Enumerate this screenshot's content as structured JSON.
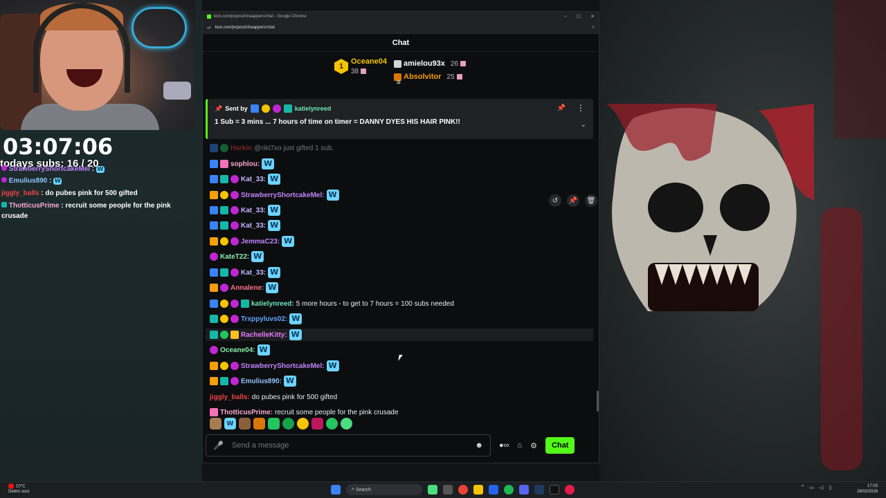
{
  "overlay": {
    "timer": "03:07:06",
    "subs_label": "todays subs: 16 / 20",
    "lines": [
      {
        "name": "StrawberryShortcakeMel",
        "color": "#c084fc",
        "sep": " :",
        "text": ""
      },
      {
        "name": "Emulius890",
        "color": "#8ec5ff",
        "sep": " :",
        "text": ""
      },
      {
        "name": "jiggly_balls",
        "color": "#ef4444",
        "sep": " :",
        "text": " do pubes pink for 500 gifted"
      },
      {
        "name": "ThotticusPrime",
        "color": "#f9a8d4",
        "sep": " :",
        "text": " recruit some people for the pink crusade"
      }
    ]
  },
  "browser": {
    "title": "kick.com/popout/chaappers/chat - Google Chrome",
    "url": "kick.com/popout/chaappers/chat"
  },
  "chat": {
    "header": "Chat",
    "leaderboard": {
      "first": {
        "rank": "1",
        "name": "Oceane04",
        "count": "38"
      },
      "others": [
        {
          "name": "amielou93x",
          "count": "26",
          "color": "#ffffff",
          "icon_color": "#d1d5db"
        },
        {
          "name": "Absolvitor",
          "count": "25",
          "color": "#f59e0b",
          "icon_color": "#d97706"
        }
      ]
    },
    "pinned": {
      "sent_by": "Sent by",
      "user": "katielynreed",
      "message": "1 Sub = 3 mins ... 7 hours of time on timer = DANNY DYES HIS HAIR PINK!!"
    },
    "messages": [
      {
        "badges": [
          "vip",
          "green"
        ],
        "user": "Harkin",
        "color": "#ef4444",
        "text": "@rikt7xo just gifted 1 sub.",
        "emote": ""
      },
      {
        "badges": [
          "vip",
          "gift"
        ],
        "user": "sophlou:",
        "color": "#f9a8d4",
        "text": "",
        "emote": "W"
      },
      {
        "badges": [
          "vip",
          "sub",
          "og"
        ],
        "user": "Kat_33:",
        "color": "#c4b5fd",
        "text": "",
        "emote": "W"
      },
      {
        "badges": [
          "crown",
          "coin",
          "og"
        ],
        "user": "StrawberryShortcakeMel:",
        "color": "#c084fc",
        "text": "",
        "emote": "W"
      },
      {
        "badges": [
          "vip",
          "sub",
          "og"
        ],
        "user": "Kat_33:",
        "color": "#c4b5fd",
        "text": "",
        "emote": "W"
      },
      {
        "badges": [
          "vip",
          "sub",
          "og"
        ],
        "user": "Kat_33:",
        "color": "#c4b5fd",
        "text": "",
        "emote": "W"
      },
      {
        "badges": [
          "crown",
          "coin",
          "og"
        ],
        "user": "JemmaC23:",
        "color": "#c084fc",
        "text": "",
        "emote": "W"
      },
      {
        "badges": [
          "og"
        ],
        "user": "KateT22:",
        "color": "#86efac",
        "text": "",
        "emote": "W"
      },
      {
        "badges": [
          "vip",
          "sub",
          "og"
        ],
        "user": "Kat_33:",
        "color": "#c4b5fd",
        "text": "",
        "emote": "W"
      },
      {
        "badges": [
          "crown",
          "og"
        ],
        "user": "Annalene:",
        "color": "#fb7185",
        "text": "",
        "emote": "W"
      },
      {
        "badges": [
          "vip",
          "coin",
          "og",
          "sub"
        ],
        "user": "katielynreed:",
        "color": "#6ee7b7",
        "text": "5 more hours - to get to 7 hours = 100 subs needed",
        "emote": ""
      },
      {
        "badges": [
          "sub",
          "coin",
          "og"
        ],
        "user": "Trxppyluvs02:",
        "color": "#60a5fa",
        "text": "",
        "emote": "W"
      },
      {
        "badges": [
          "sub",
          "green",
          "box"
        ],
        "user": "RachelleKitty:",
        "color": "#e879f9",
        "text": "",
        "emote": "W"
      },
      {
        "badges": [
          "og"
        ],
        "user": "Oceane04:",
        "color": "#86efac",
        "text": "",
        "emote": "W"
      },
      {
        "badges": [
          "crown",
          "coin",
          "og"
        ],
        "user": "StrawberryShortcakeMel:",
        "color": "#c084fc",
        "text": "",
        "emote": "W"
      },
      {
        "badges": [
          "crown",
          "sub",
          "og"
        ],
        "user": "Emulius890:",
        "color": "#93c5fd",
        "text": "",
        "emote": "W"
      },
      {
        "badges": [],
        "user": "jiggly_balls:",
        "color": "#ef4444",
        "text": "do pubes pink for 500 gifted",
        "emote": ""
      },
      {
        "badges": [
          "gift"
        ],
        "user": "ThotticusPrime:",
        "color": "#f9a8d4",
        "text": "recruit some people for the pink crusade",
        "emote": ""
      }
    ],
    "input_placeholder": "Send a message",
    "send_label": "Chat"
  },
  "taskbar": {
    "weather_temp": "10°C",
    "weather_desc": "Debris soul",
    "search_label": "Search",
    "time": "17:03",
    "date": "28/02/2026"
  },
  "colors": {
    "kick_green": "#53fc18",
    "gold": "#f5c400"
  }
}
